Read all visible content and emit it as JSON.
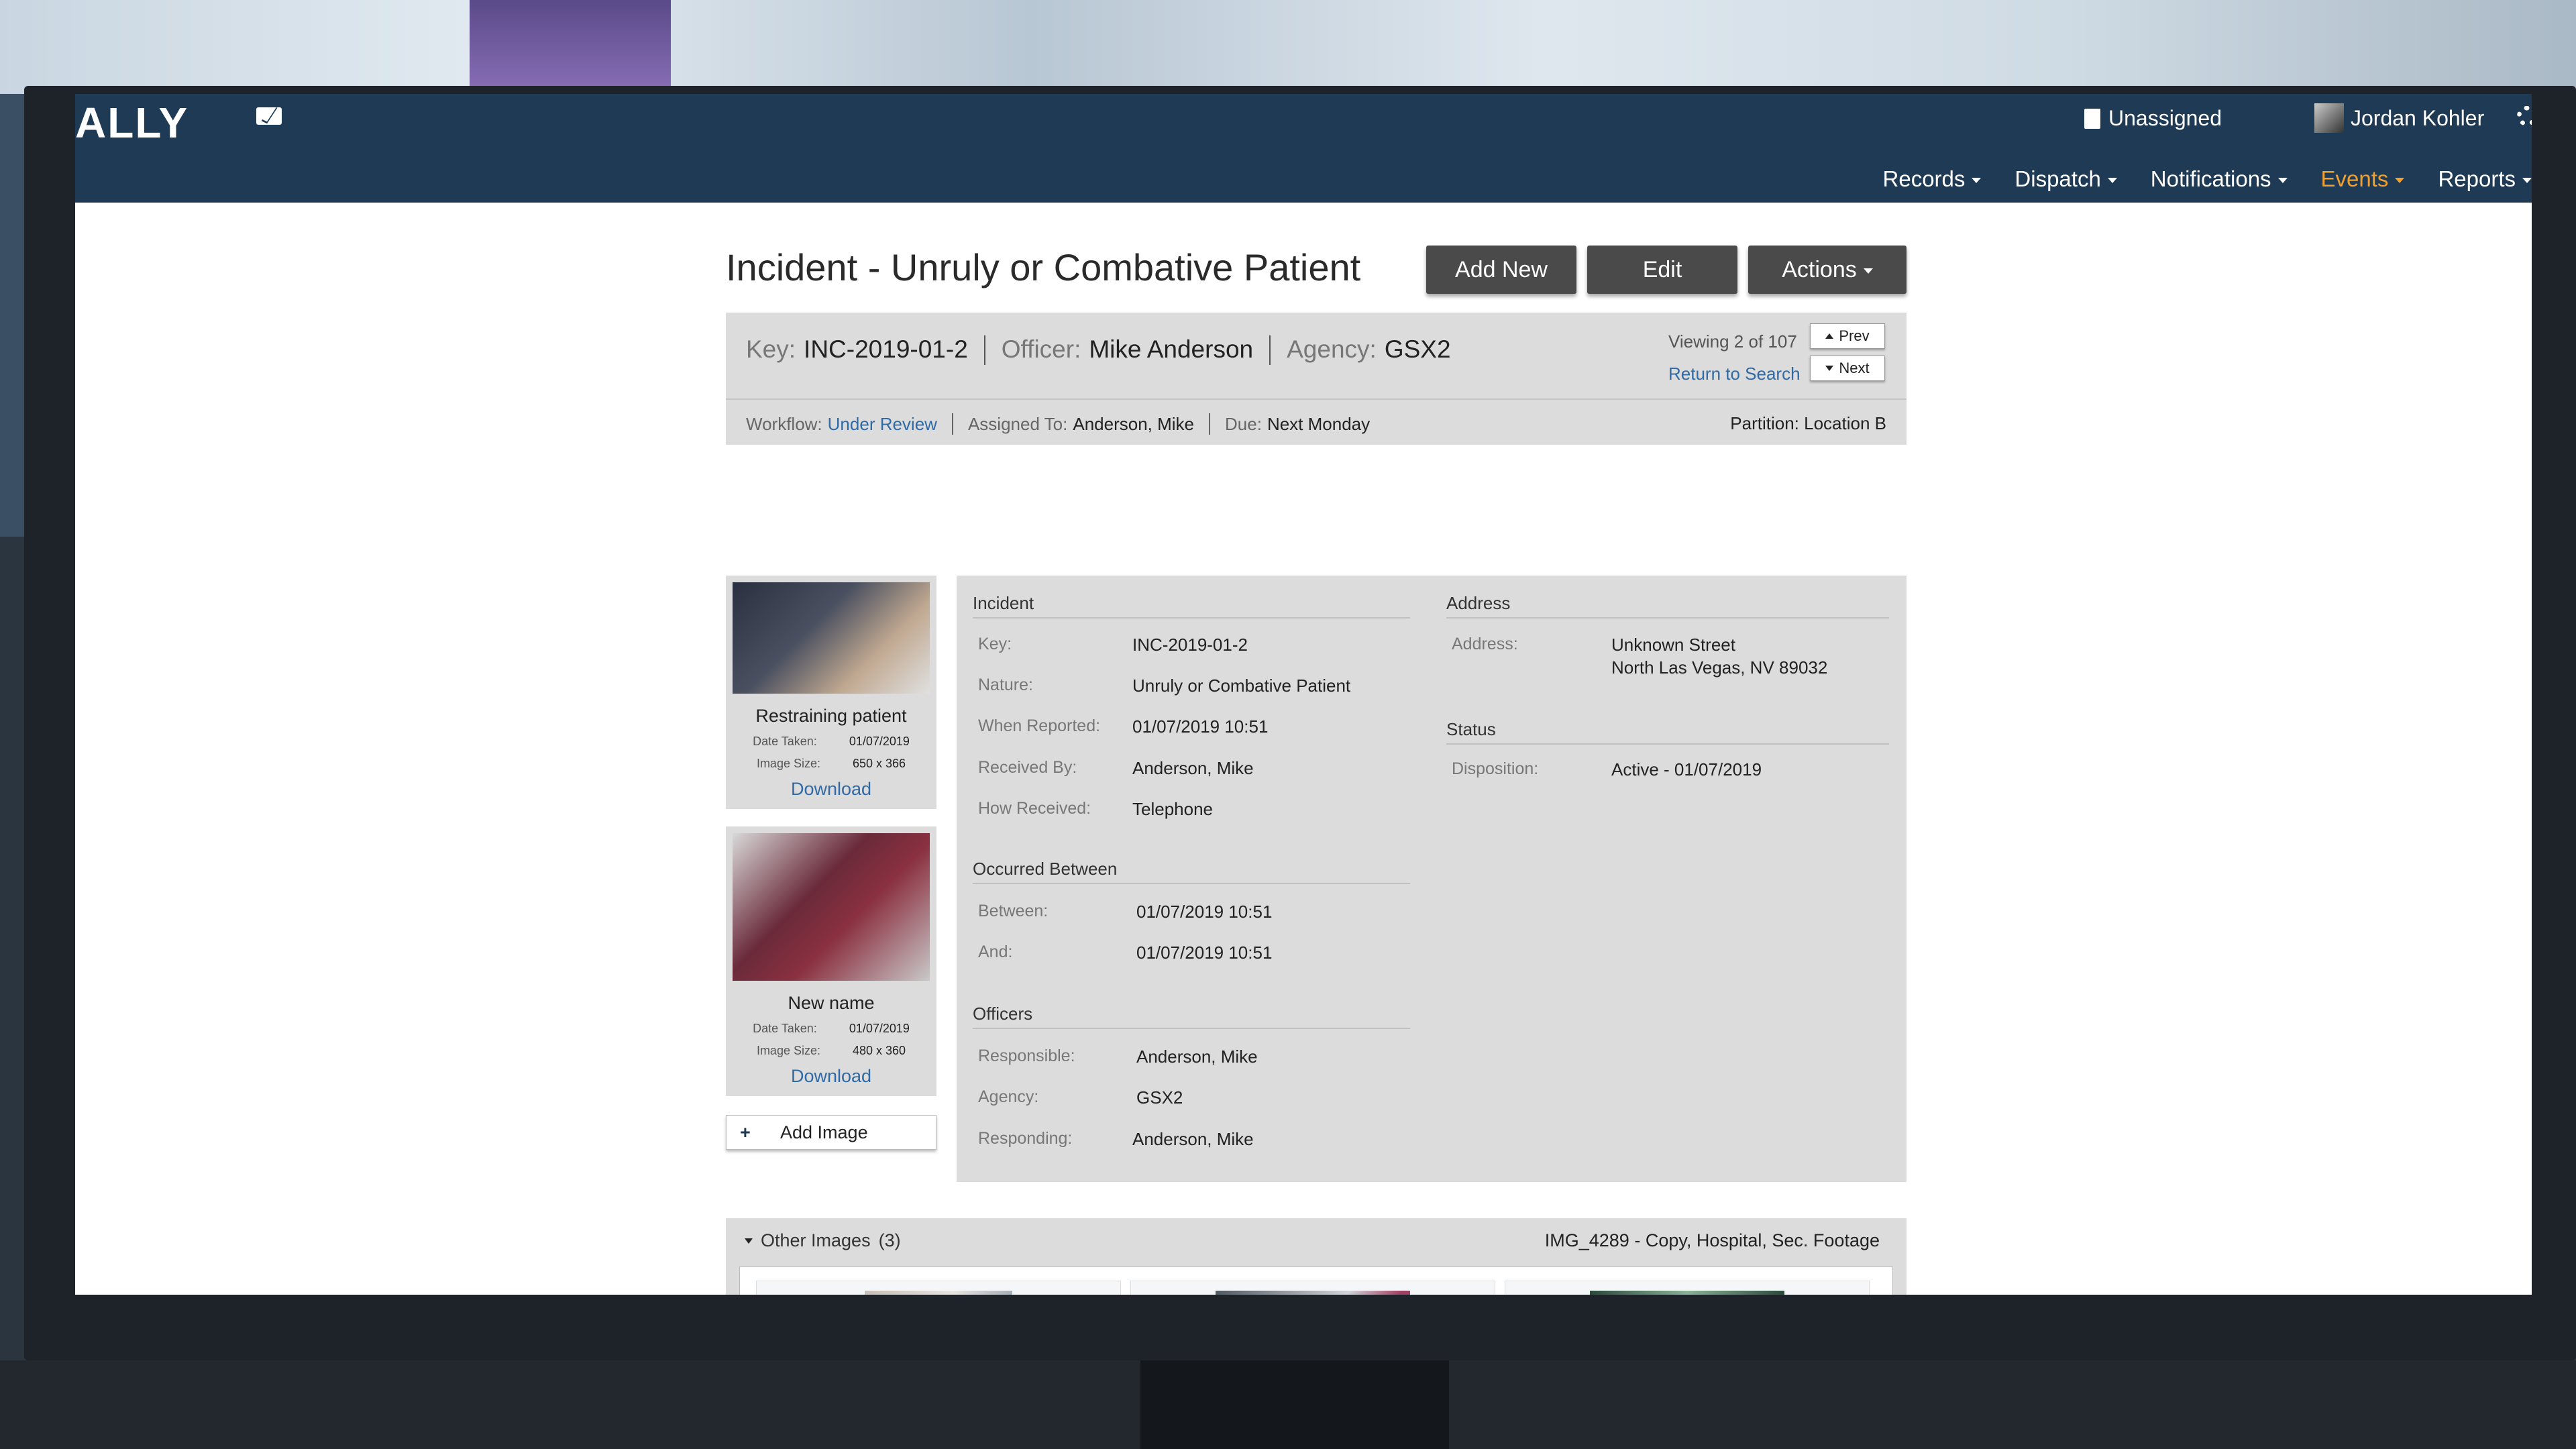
{
  "header": {
    "logo": "ALLY",
    "unassigned": "Unassigned",
    "user_name": "Jordan Kohler",
    "nav": [
      {
        "label": "Records",
        "active": false
      },
      {
        "label": "Dispatch",
        "active": false
      },
      {
        "label": "Notifications",
        "active": false
      },
      {
        "label": "Events",
        "active": true
      },
      {
        "label": "Reports",
        "active": false
      }
    ],
    "accent_color": "#f0a030"
  },
  "page": {
    "title": "Incident - Unruly or Combative Patient",
    "buttons": {
      "add_new": "Add New",
      "edit": "Edit",
      "actions": "Actions"
    }
  },
  "summary": {
    "key_label": "Key:",
    "key_value": "INC-2019-01-2",
    "officer_label": "Officer:",
    "officer_value": "Mike Anderson",
    "agency_label": "Agency:",
    "agency_value": "GSX2",
    "viewing": "Viewing 2 of 107",
    "return_to_search": "Return to Search",
    "prev": "Prev",
    "next": "Next",
    "workflow_label": "Workflow:",
    "workflow_value": "Under Review",
    "assigned_label": "Assigned To:",
    "assigned_value": "Anderson, Mike",
    "due_label": "Due:",
    "due_value": "Next Monday",
    "partition": "Partition: Location B"
  },
  "images": [
    {
      "name": "Restraining patient",
      "date_label": "Date Taken:",
      "date": "01/07/2019",
      "size_label": "Image Size:",
      "size": "650 x 366",
      "download": "Download"
    },
    {
      "name": "New name",
      "date_label": "Date Taken:",
      "date": "01/07/2019",
      "size_label": "Image Size:",
      "size": "480 x 360",
      "download": "Download"
    }
  ],
  "add_image": "Add Image",
  "incident": {
    "heading": "Incident",
    "fields": [
      {
        "label": "Key:",
        "value": "INC-2019-01-2"
      },
      {
        "label": "Nature:",
        "value": "Unruly or Combative Patient"
      },
      {
        "label": "When Reported:",
        "value": "01/07/2019 10:51"
      },
      {
        "label": "Received By:",
        "value": "Anderson, Mike"
      },
      {
        "label": "How Received:",
        "value": "Telephone"
      }
    ]
  },
  "occurred": {
    "heading": "Occurred Between",
    "fields": [
      {
        "label": "Between:",
        "value": "01/07/2019 10:51"
      },
      {
        "label": "And:",
        "value": "01/07/2019 10:51"
      }
    ]
  },
  "officers": {
    "heading": "Officers",
    "fields": [
      {
        "label": "Responsible:",
        "value": "Anderson, Mike"
      },
      {
        "label": "Agency:",
        "value": "GSX2"
      },
      {
        "label": "Responding:",
        "value": "Anderson, Mike"
      }
    ]
  },
  "address": {
    "heading": "Address",
    "label": "Address:",
    "line1": "Unknown Street",
    "line2": "North Las Vegas, NV 89032"
  },
  "status": {
    "heading": "Status",
    "label": "Disposition:",
    "value": "Active - 01/07/2019"
  },
  "other_images": {
    "title": "Other Images",
    "count": "(3)",
    "caption": "IMG_4289 - Copy, Hospital, Sec. Footage"
  }
}
